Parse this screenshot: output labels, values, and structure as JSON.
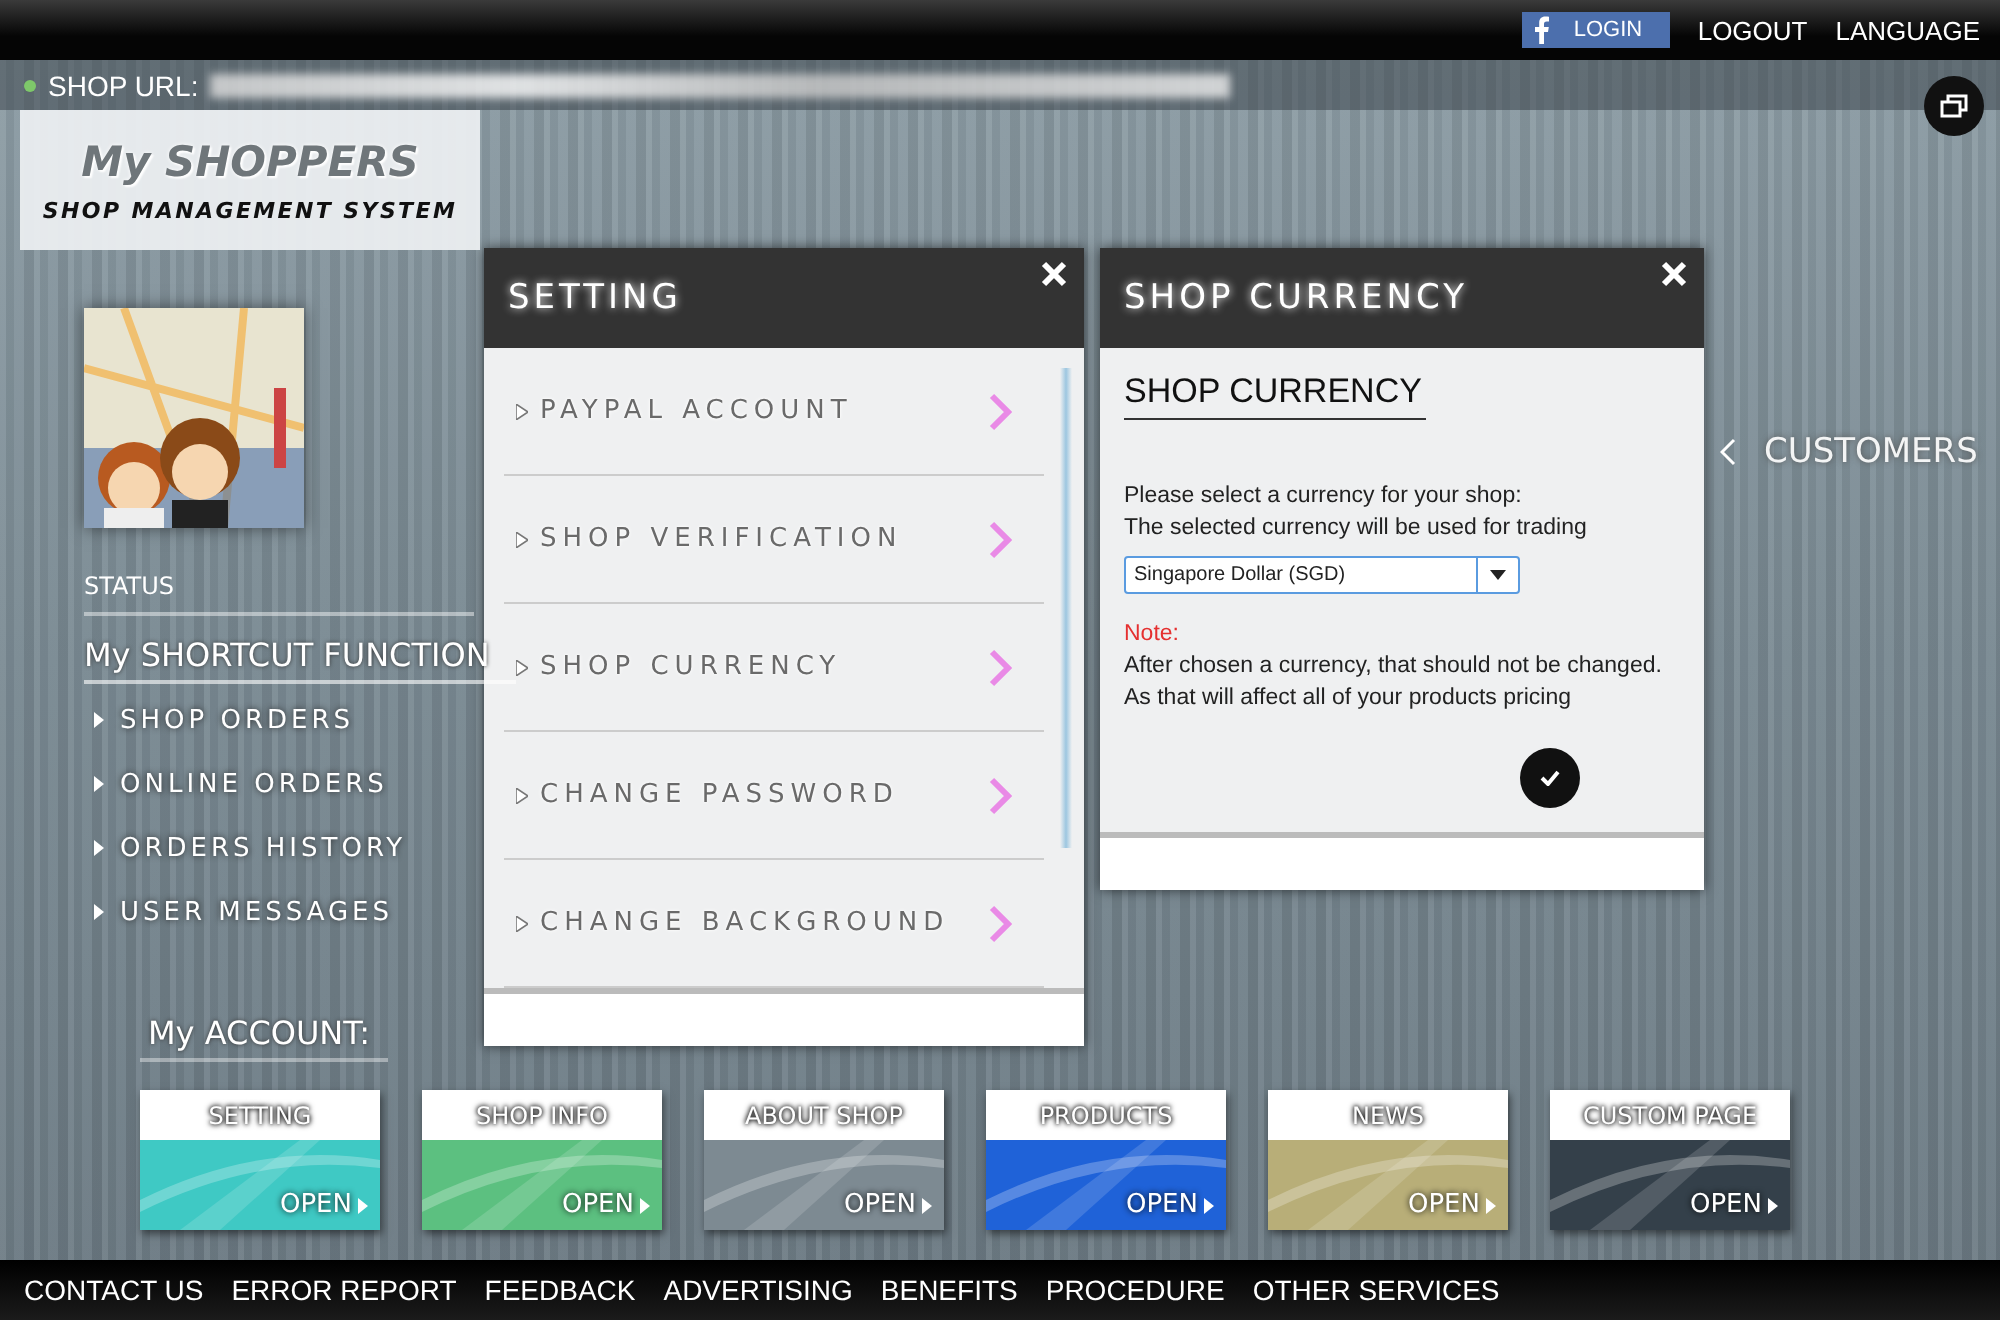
{
  "top_bar": {
    "login_button": "LOGIN",
    "links": [
      "LOGOUT",
      "LANGUAGE"
    ]
  },
  "url_bar": {
    "label": "SHOP URL:"
  },
  "logo": {
    "title": "My SHOPPERS",
    "subtitle": "SHOP MANAGEMENT SYSTEM"
  },
  "sidebar": {
    "status_label": "STATUS",
    "shortcut_title": "My SHORTCUT FUNCTION",
    "shortcuts": [
      "SHOP ORDERS",
      "ONLINE ORDERS",
      "ORDERS HISTORY",
      "USER MESSAGES"
    ]
  },
  "customers_label": "CUSTOMERS",
  "setting_dialog": {
    "title": "SETTING",
    "items": [
      "PAYPAL ACCOUNT",
      "SHOP VERIFICATION",
      "SHOP CURRENCY",
      "CHANGE PASSWORD",
      "CHANGE BACKGROUND"
    ]
  },
  "currency_dialog": {
    "title": "SHOP CURRENCY",
    "heading": "SHOP CURRENCY",
    "intro": [
      "Please select a currency for your shop:",
      "The selected currency will be used for trading"
    ],
    "select": {
      "value": "Singapore Dollar (SGD)"
    },
    "note_label": "Note:",
    "note_lines": [
      "After chosen a currency, that should not be changed.",
      "As that will affect all of your products pricing"
    ]
  },
  "account": {
    "title": "My ACCOUNT:",
    "tiles": [
      {
        "title": "SETTING",
        "action": "OPEN",
        "color": "#3fc9c4"
      },
      {
        "title": "SHOP INFO",
        "action": "OPEN",
        "color": "#5cc080"
      },
      {
        "title": "ABOUT SHOP",
        "action": "OPEN",
        "color": "#7d8a92"
      },
      {
        "title": "PRODUCTS",
        "action": "OPEN",
        "color": "#1f62d8"
      },
      {
        "title": "NEWS",
        "action": "OPEN",
        "color": "#b8ae78"
      },
      {
        "title": "CUSTOM PAGE",
        "action": "OPEN",
        "color": "#34404a"
      }
    ]
  },
  "footer": {
    "links": [
      "CONTACT US",
      "ERROR REPORT",
      "FEEDBACK",
      "ADVERTISING",
      "BENEFITS",
      "PROCEDURE",
      "OTHER SERVICES"
    ]
  }
}
